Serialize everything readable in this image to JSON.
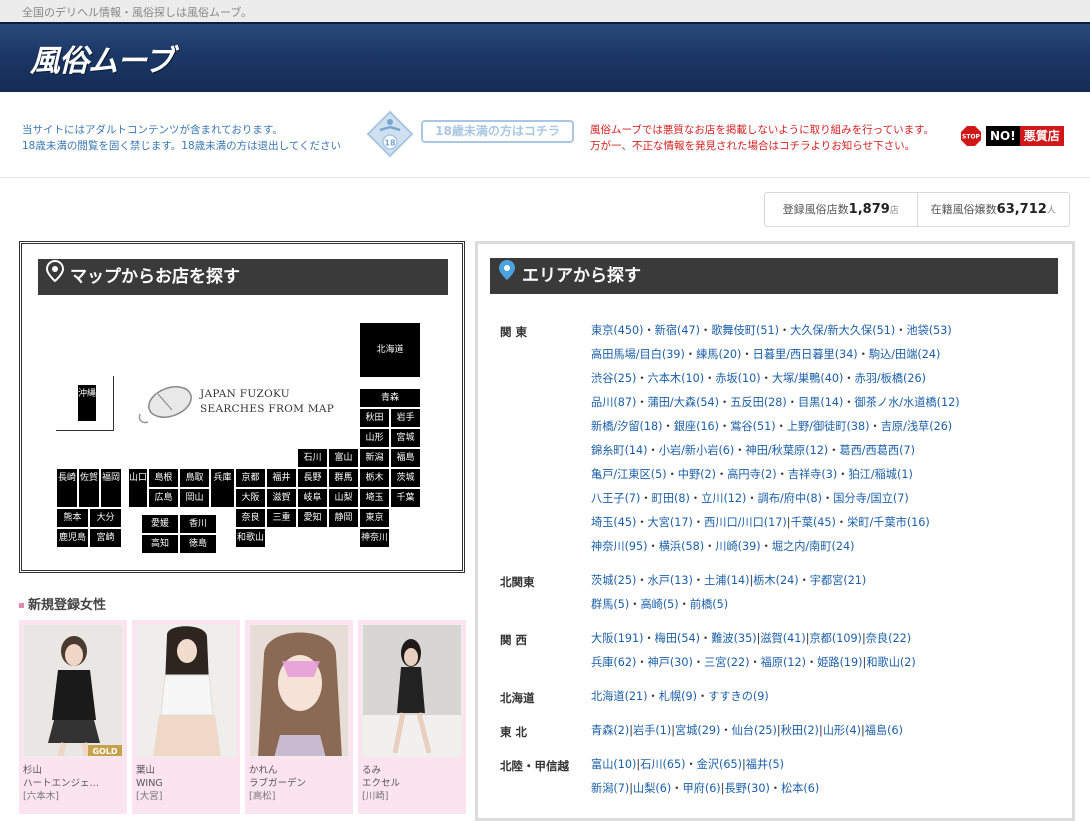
{
  "top_bar": {
    "text": "全国のデリヘル情報・風俗探しは風俗ムーブ。"
  },
  "header": {
    "logo": "風俗ムーブ"
  },
  "notice": {
    "left_line1": "当サイトにはアダルトコンテンツが含まれております。",
    "left_line2": "18歳未満の閲覧を固く禁じます。18歳未満の方は退出してください",
    "age_badge": "18",
    "under18_button": "18歳未満の方はコチラ",
    "right_line1": "風俗ムーブでは悪質なお店を掲載しないように取り組みを行っています。",
    "right_line2": "万が一、不正な情報を発見された場合はコチラよりお知らせ下さい。",
    "stop_badge": "STOP",
    "no_badge": "NO!",
    "bad_shop": "悪質店"
  },
  "counts": {
    "shops_label": "登録風俗店数",
    "shops_value": "1,879",
    "shops_unit": "店",
    "girls_label": "在籍風俗嬢数",
    "girls_value": "63,712",
    "girls_unit": "人"
  },
  "map": {
    "title": "マップからお店を探す",
    "caption_line1": "JAPAN FUZOKU",
    "caption_line2": "SEARCHES FROM MAP",
    "prefectures": {
      "hokkaido": "北海道",
      "aomori": "青森",
      "akita": "秋田",
      "iwate": "岩手",
      "yamagata": "山形",
      "miyagi": "宮城",
      "ishikawa": "石川",
      "toyama": "富山",
      "niigata": "新潟",
      "fukushima": "福島",
      "nagano": "長野",
      "gunma": "群馬",
      "tochigi": "栃木",
      "ibaraki": "茨城",
      "kyoto": "京都",
      "fukui": "福井",
      "gifu": "岐阜",
      "yamanashi": "山梨",
      "saitama": "埼玉",
      "chiba": "千葉",
      "osaka": "大阪",
      "shiga": "滋賀",
      "aichi": "愛知",
      "shizuoka": "静岡",
      "tokyo": "東京",
      "nara": "奈良",
      "mie": "三重",
      "kanagawa": "神奈川",
      "wakayama": "和歌山",
      "shimane": "島根",
      "tottori": "鳥取",
      "hyogo": "兵庫",
      "hiroshima": "広島",
      "okayama": "岡山",
      "yamaguchi": "山口",
      "ehime": "愛媛",
      "kagawa": "香川",
      "kochi": "高知",
      "tokushima": "徳島",
      "nagasaki": "長崎",
      "saga": "佐賀",
      "fukuoka": "福岡",
      "kumamoto": "熊本",
      "oita": "大分",
      "kagoshima": "鹿児島",
      "miyazaki": "宮崎",
      "okinawa": "沖縄"
    }
  },
  "new_girls": {
    "title": "新規登録女性",
    "items": [
      {
        "name": "杉山",
        "shop": "ハートエンジェ…",
        "area": "[六本木]",
        "badge": "GOLD"
      },
      {
        "name": "葉山",
        "shop": "WING",
        "area": "[大宮]"
      },
      {
        "name": "かれん",
        "shop": "ラブガーデン",
        "area": "[高松]"
      },
      {
        "name": "るみ",
        "shop": "エクセル",
        "area": "[川崎]"
      }
    ]
  },
  "area": {
    "title": "エリアから探す",
    "regions": [
      {
        "name": "関 東",
        "lines": [
          "東京(450)・新宿(47)・歌舞伎町(51)・大久保/新大久保(51)・池袋(53)",
          "高田馬場/目白(39)・練馬(20)・日暮里/西日暮里(34)・駒込/田端(24)",
          "渋谷(25)・六本木(10)・赤坂(10)・大塚/巣鴨(40)・赤羽/板橋(26)",
          "品川(87)・蒲田/大森(54)・五反田(28)・目黒(14)・御茶ノ水/水道橋(12)",
          "新橋/汐留(18)・銀座(16)・鴬谷(51)・上野/御徒町(38)・吉原/浅草(26)",
          "錦糸町(14)・小岩/新小岩(6)・神田/秋葉原(12)・葛西/西葛西(7)",
          "亀戸/江東区(5)・中野(2)・高円寺(2)・吉祥寺(3)・狛江/稲城(1)",
          "八王子(7)・町田(8)・立川(12)・調布/府中(8)・国分寺/国立(7)",
          "埼玉(45)・大宮(17)・西川口/川口(17)|千葉(45)・栄町/千葉市(16)",
          "神奈川(95)・横浜(58)・川崎(39)・堀之内/南町(24)"
        ]
      },
      {
        "name": "北関東",
        "lines": [
          "茨城(25)・水戸(13)・土浦(14)|栃木(24)・宇都宮(21)",
          "群馬(5)・高崎(5)・前橋(5)"
        ]
      },
      {
        "name": "関 西",
        "lines": [
          "大阪(191)・梅田(54)・難波(35)|滋賀(41)|京都(109)|奈良(22)",
          "兵庫(62)・神戸(30)・三宮(22)・福原(12)・姫路(19)|和歌山(2)"
        ]
      },
      {
        "name": "北海道",
        "lines": [
          "北海道(21)・札幌(9)・すすきの(9)"
        ]
      },
      {
        "name": "東 北",
        "lines": [
          "青森(2)|岩手(1)|宮城(29)・仙台(25)|秋田(2)|山形(4)|福島(6)"
        ]
      },
      {
        "name": "北陸・甲信越",
        "lines": [
          "富山(10)|石川(65)・金沢(65)|福井(5)",
          "新潟(7)|山梨(6)・甲府(6)|長野(30)・松本(6)"
        ]
      }
    ]
  }
}
